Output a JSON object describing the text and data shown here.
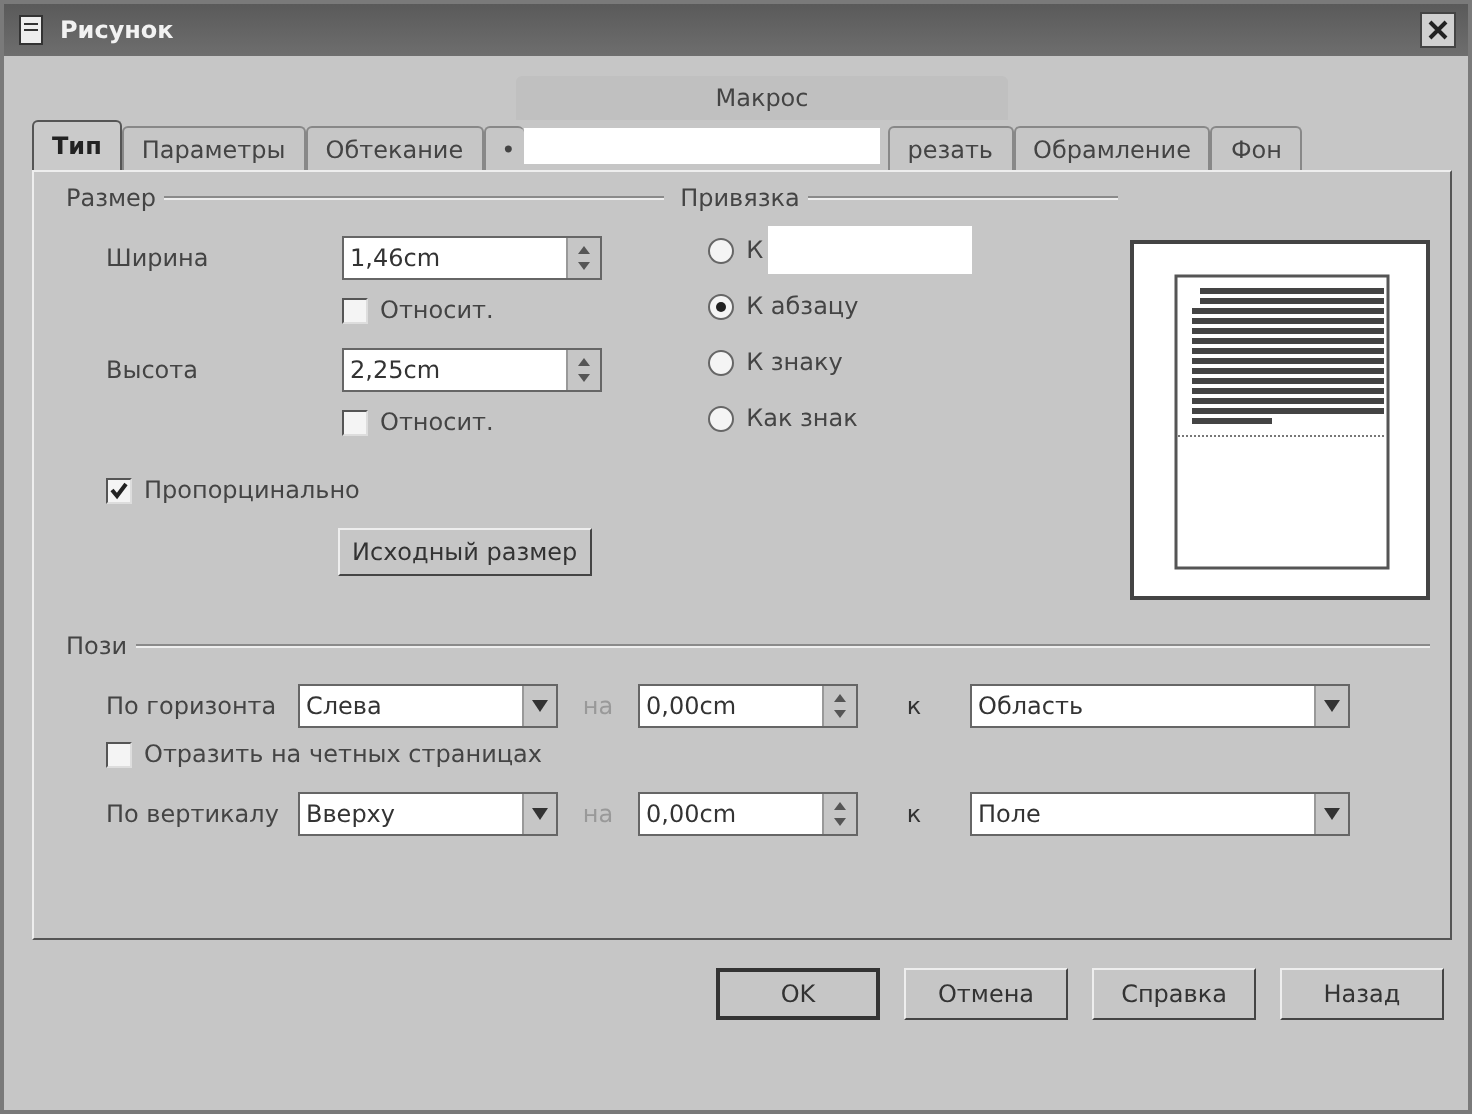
{
  "window": {
    "title": "Рисунок"
  },
  "tabs_top": [
    {
      "label": "Макрос",
      "selected": false
    }
  ],
  "tabs": [
    {
      "label": "Тип",
      "selected": true
    },
    {
      "label": "Параметры",
      "selected": false
    },
    {
      "label": "Обтекание",
      "selected": false
    },
    {
      "label": "•",
      "selected": false,
      "kind": "covered"
    },
    {
      "label": "резать",
      "selected": false
    },
    {
      "label": "Обрамление",
      "selected": false
    },
    {
      "label": "Фон",
      "selected": false
    }
  ],
  "size": {
    "title": "Размер",
    "fields": [
      {
        "label": "Ширина",
        "value": "1,46cm",
        "relative": {
          "label": "Относит.",
          "checked": false
        }
      },
      {
        "label": "Высота",
        "value": "2,25cm",
        "relative": {
          "label": "Относит.",
          "checked": false
        }
      }
    ],
    "keep_ratio": {
      "label": "Пропорцинально",
      "checked": true
    },
    "original_size_button": "Исходный размер"
  },
  "anchor": {
    "title": "Привязка",
    "options": [
      {
        "label": "К",
        "selected": false,
        "kind": "covered"
      },
      {
        "label": "К абзацу",
        "selected": true
      },
      {
        "label": "К знаку",
        "selected": false
      },
      {
        "label": "Как знак",
        "selected": false
      }
    ]
  },
  "position": {
    "title": "Пози",
    "horizontal": {
      "label": "По горизонта",
      "value": "Слева",
      "by_label": "на",
      "by_value": "0,00cm",
      "to_label": "к",
      "to_value": "Область"
    },
    "mirror": {
      "label": "Отразить на четных страницах",
      "checked": false
    },
    "vertical": {
      "label": "По вертикалу",
      "value": "Вверху",
      "by_label": "на",
      "by_value": "0,00cm",
      "to_label": "к",
      "to_value": "Поле"
    }
  },
  "buttons": [
    {
      "label": "OK",
      "default": true
    },
    {
      "label": "Отмена",
      "default": false
    },
    {
      "label": "Справка",
      "default": false
    },
    {
      "label": "Назад",
      "default": false
    }
  ]
}
